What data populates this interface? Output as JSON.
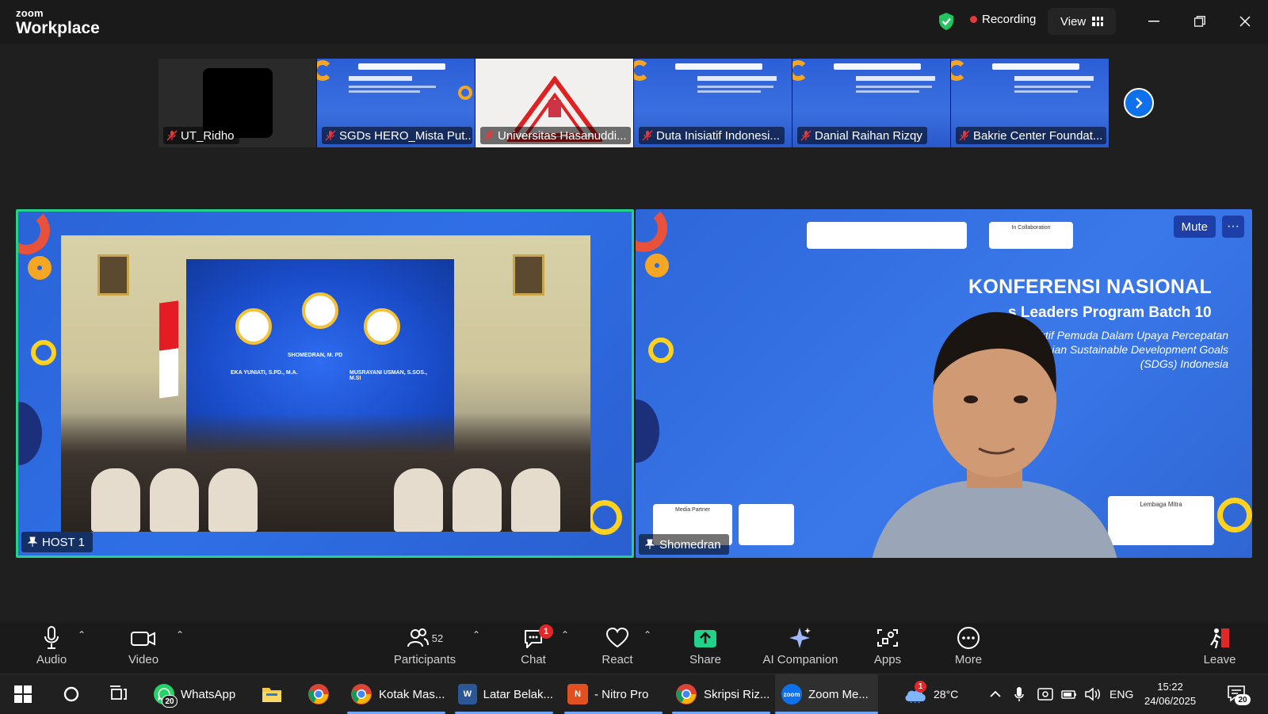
{
  "app": {
    "brand_small": "zoom",
    "brand_big": "Workplace"
  },
  "titlebar": {
    "recording_label": "Recording",
    "view_label": "View"
  },
  "filmstrip": {
    "participants": [
      {
        "name": "UT_Ridho",
        "kind": "dark"
      },
      {
        "name": "SGDs HERO_Mista Put...",
        "kind": "slide"
      },
      {
        "name": "Universitas Hasanuddi...",
        "kind": "white"
      },
      {
        "name": "Duta Inisiatif Indonesi...",
        "kind": "slide"
      },
      {
        "name": "Danial Raihan Rizqy",
        "kind": "slide"
      },
      {
        "name": "Bakrie Center Foundat...",
        "kind": "slide"
      }
    ]
  },
  "main_videos": {
    "left": {
      "name": "HOST 1"
    },
    "right": {
      "name": "Shomedran",
      "mute_label": "Mute",
      "more_label": "···",
      "slide_title": "KONFERENSI NASIONAL",
      "slide_subtitle": "s Leaders Program Batch 10",
      "slide_desc_1": "Aktif Pemuda Dalam Upaya Percepatan",
      "slide_desc_2": "paian Sustainable Development Goals",
      "slide_desc_3": "(SDGs) Indonesia",
      "partner_label": "Lembaga Mitra",
      "media_label": "Media Partner",
      "collab_label": "In Collaboration"
    },
    "stage_people": {
      "p1": "EKA YUNIATI, S.PD., M.A.",
      "p2": "SHOMEDRAN, M. PD",
      "p3": "MUSRAYANI USMAN, S.SOS., M.SI"
    }
  },
  "toolbar": {
    "audio_label": "Audio",
    "video_label": "Video",
    "participants_label": "Participants",
    "participants_count": "52",
    "chat_label": "Chat",
    "chat_badge": "1",
    "react_label": "React",
    "share_label": "Share",
    "ai_label": "AI Companion",
    "apps_label": "Apps",
    "more_label": "More",
    "leave_label": "Leave"
  },
  "taskbar": {
    "items": [
      {
        "label": "WhatsApp"
      },
      {
        "label": "Kotak Mas..."
      },
      {
        "label": "Latar Belak..."
      },
      {
        "label": "- Nitro Pro"
      },
      {
        "label": "Skripsi Riz..."
      },
      {
        "label": "Zoom Me..."
      }
    ],
    "whatsapp_badge": "20",
    "weather_badge": "1",
    "temperature": "28°C",
    "language": "ENG",
    "time": "15:22",
    "date": "24/06/2025",
    "notif_count": "20"
  },
  "colors": {
    "accent_blue": "#0e71eb",
    "active_speaker": "#23d18b",
    "recording_red": "#e03b3b",
    "share_green": "#23d18b",
    "slide_orange": "#f5a623"
  }
}
